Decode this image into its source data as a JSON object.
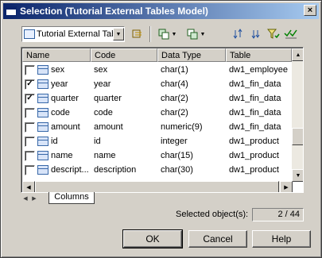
{
  "window": {
    "title": "Selection (Tutorial External Tables Model)",
    "close_label": "×"
  },
  "toolbar": {
    "model_select_value": "Tutorial External Table",
    "buttons": [
      "include-icon",
      "select-all-icon",
      "dropdown-arrow",
      "copy-icon",
      "dropdown-arrow",
      "move-to-bottom-icon",
      "move-down-icon",
      "filter-icon",
      "check-all-icon"
    ]
  },
  "grid": {
    "columns": [
      "Name",
      "Code",
      "Data Type",
      "Table"
    ],
    "rows": [
      {
        "checked": false,
        "name": "sex",
        "code": "sex",
        "data_type": "char(1)",
        "table": "dw1_employee"
      },
      {
        "checked": true,
        "name": "year",
        "code": "year",
        "data_type": "char(4)",
        "table": "dw1_fin_data"
      },
      {
        "checked": true,
        "name": "quarter",
        "code": "quarter",
        "data_type": "char(2)",
        "table": "dw1_fin_data"
      },
      {
        "checked": false,
        "name": "code",
        "code": "code",
        "data_type": "char(2)",
        "table": "dw1_fin_data"
      },
      {
        "checked": false,
        "name": "amount",
        "code": "amount",
        "data_type": "numeric(9)",
        "table": "dw1_fin_data"
      },
      {
        "checked": false,
        "name": "id",
        "code": "id",
        "data_type": "integer",
        "table": "dw1_product"
      },
      {
        "checked": false,
        "name": "name",
        "code": "name",
        "data_type": "char(15)",
        "table": "dw1_product"
      },
      {
        "checked": false,
        "name": "descript...",
        "code": "description",
        "data_type": "char(30)",
        "table": "dw1_product"
      }
    ]
  },
  "tabs": [
    {
      "label": "Columns"
    }
  ],
  "status": {
    "selected_label": "Selected object(s):",
    "selected_count": "2 / 44"
  },
  "buttons": {
    "ok": "OK",
    "cancel": "Cancel",
    "help": "Help"
  }
}
